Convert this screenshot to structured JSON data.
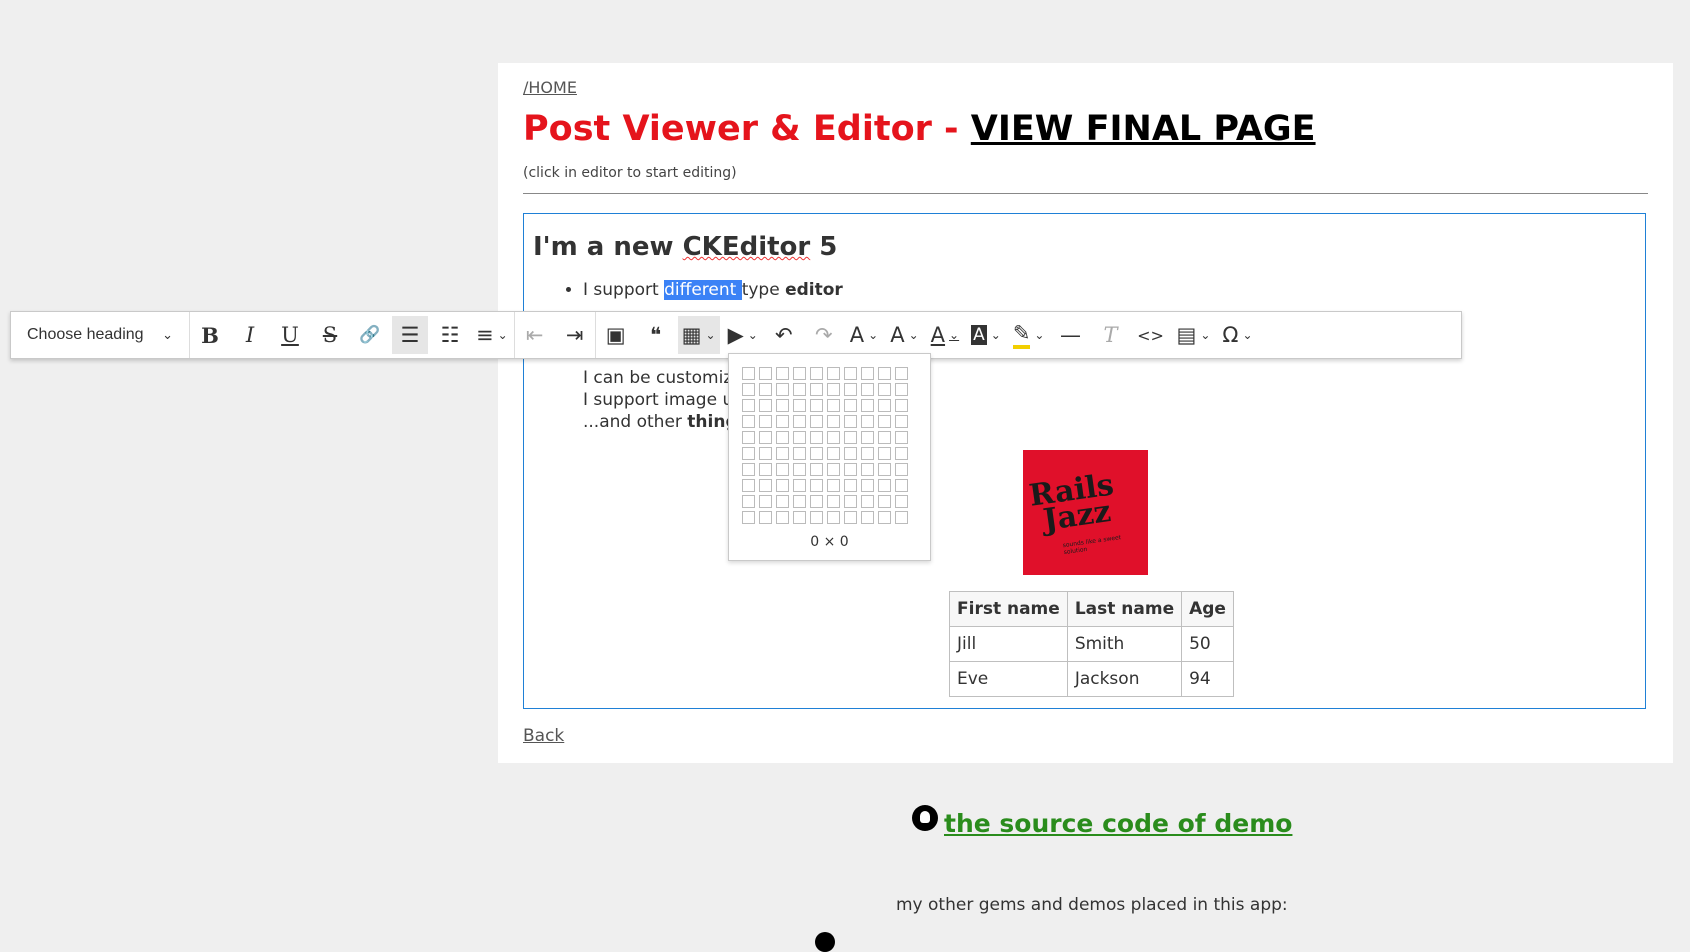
{
  "nav": {
    "home": "/HOME"
  },
  "header": {
    "title": "Post Viewer & Editor - ",
    "view_link": "VIEW FINAL PAGE",
    "hint": "(click in editor to start editing)"
  },
  "editor": {
    "heading_prefix": "I'm a new ",
    "heading_spell": "CKEditor",
    "heading_suffix": " 5",
    "line1_a": "I support ",
    "line1_selected": "different ",
    "line1_b": "type ",
    "line1_bold": "editor",
    "items": [
      {
        "text": "I can be customiz",
        "bold": ""
      },
      {
        "text": "I support image u",
        "bold": ""
      },
      {
        "text": "...and other ",
        "bold": "thing"
      }
    ],
    "table": {
      "headers": [
        "First name",
        "Last name",
        "Age"
      ],
      "rows": [
        [
          "Jill",
          "Smith",
          "50"
        ],
        [
          "Eve",
          "Jackson",
          "94"
        ]
      ]
    },
    "logo": {
      "line1": "Rails",
      "line2": "Jazz",
      "tagline": "sounds like a sweet solution"
    }
  },
  "toolbar": {
    "heading_label": "Choose heading",
    "icons": {
      "bold": "B",
      "italic": "I",
      "underline": "U",
      "strike": "S",
      "link": "🔗",
      "bulleted": "☰",
      "numbered": "☷",
      "align": "≡",
      "outdent": "⇤",
      "indent": "⇥",
      "image": "▣",
      "quote": "❝",
      "table": "▦",
      "media": "▶",
      "undo": "↶",
      "redo": "↷",
      "font_family": "A",
      "font_size": "A",
      "font_color": "A",
      "font_bg": "A",
      "highlight": "✎",
      "hr": "—",
      "remove_format": "T",
      "source": "<>",
      "template": "▤",
      "special": "Ω"
    }
  },
  "grid_panel": {
    "label": "0 × 0"
  },
  "footer": {
    "back": "Back",
    "source_link": "the source code of demo",
    "other": "my other gems and demos placed in this app:"
  }
}
